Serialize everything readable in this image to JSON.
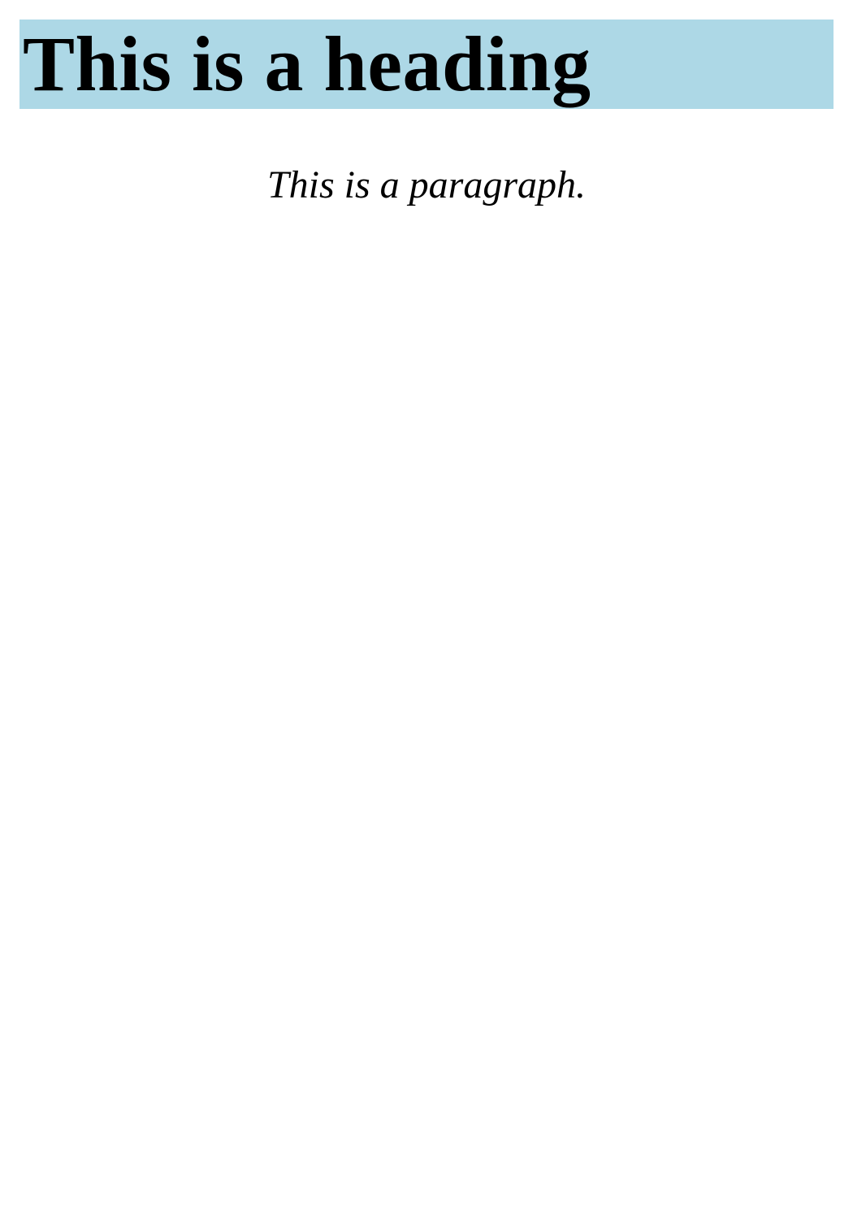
{
  "heading": {
    "text": "This is a heading",
    "background_color": "#add8e6"
  },
  "paragraph": {
    "text": "This is a paragraph."
  }
}
